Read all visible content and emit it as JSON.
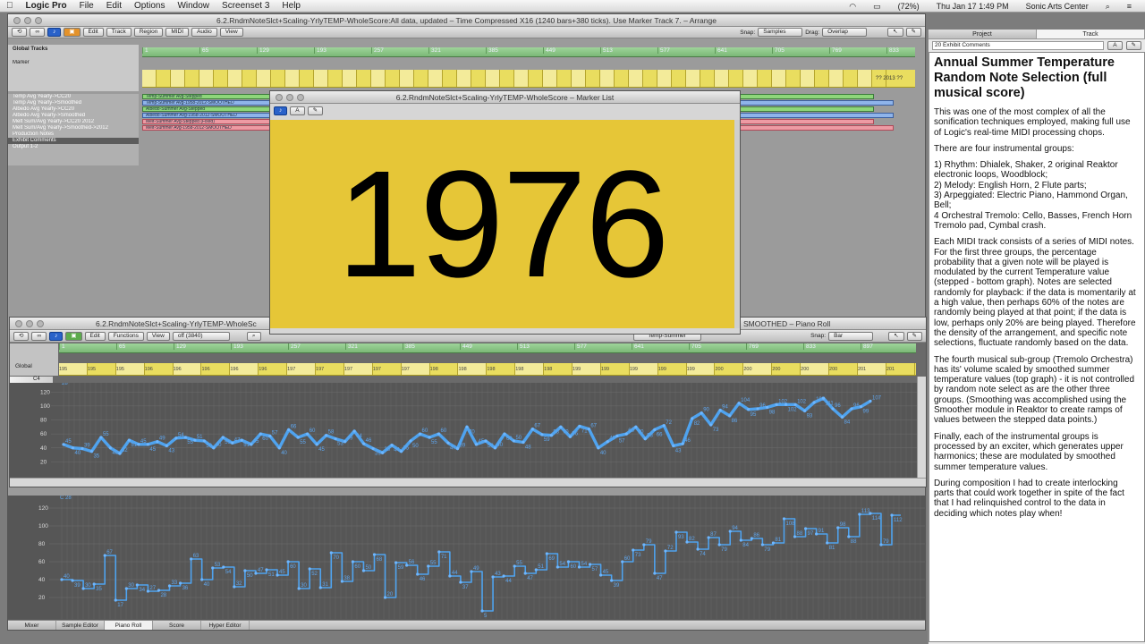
{
  "menubar": {
    "app": "Logic Pro",
    "items": [
      "File",
      "Edit",
      "Options",
      "Window",
      "Screenset 3",
      "Help"
    ],
    "battery": "(72%)",
    "clock": "Thu Jan 17  1:49 PM",
    "user": "Sonic Arts Center"
  },
  "arrange": {
    "title": "6.2.RndmNoteSlct+Scaling-YrlyTEMP-WholeScore:All data, updated – Time Compressed X16 (1240 bars+380 ticks).  Use Marker Track 7. – Arrange",
    "menus": [
      "Edit",
      "Track",
      "Region",
      "MIDI",
      "Audio",
      "View"
    ],
    "snap_label": "Snap:",
    "snap_value": "Samples",
    "drag_label": "Drag:",
    "drag_value": "Overlap",
    "global_tracks": "Global Tracks",
    "marker_label": "Marker",
    "ruler": [
      "1",
      "65",
      "129",
      "193",
      "257",
      "321",
      "385",
      "449",
      "513",
      "577",
      "641",
      "705",
      "769",
      "833",
      "897",
      "961",
      "1025",
      "1089",
      "1153",
      "1217",
      "1281"
    ],
    "marker_tail": "?? 2013 ??",
    "tracks": [
      "Temp Avg Yearly->CC20",
      "Temp Avg Yearly->Smoothed",
      "Albedo Avg Yearly->CC20",
      "Albedo Avg Yearly->Smoothed",
      "Melt Sum/Avg Yearly->CC20 2012",
      "Melt Sum/Avg Yearly->Smoothed->2012",
      "Production Notes",
      "Exhibit Comments",
      "Output 1-2"
    ],
    "regions": [
      "Temp-Summer Avg-Stepped",
      "Temp-Summer Avg-1958-2012-SMOOTHED",
      "Albedo-Summer Avg-Stepped",
      "Albedo-Summer Avg-1958-2012-SMOOTHED",
      "Melt-Summer Avg-Stepped (Fixed)",
      "Melt-Summer Avg-1958-2012-SMOOTHED"
    ]
  },
  "marker_list": {
    "title": "6.2.RndmNoteSlct+Scaling-YrlyTEMP-WholeScore – Marker List",
    "big_year": "1976"
  },
  "piano_roll": {
    "title_left": "6.2.RndmNoteSlct+Scaling-YrlyTEMP-WholeSc",
    "title_right": "SMOOTHED – Piano Roll",
    "menus": [
      "Edit",
      "Functions",
      "View"
    ],
    "off_value": "off (3840)",
    "region_name": "Temp-Summer",
    "snap_label": "Snap:",
    "snap_value": "Bar",
    "global_label": "Global",
    "c4_label": "C4",
    "ruler": [
      "1",
      "65",
      "129",
      "193",
      "257",
      "321",
      "385",
      "449",
      "513",
      "577",
      "641",
      "705",
      "769",
      "833",
      "897",
      "961",
      "1025",
      "1089",
      "1153",
      "1217"
    ],
    "marker_years": [
      "195",
      "195",
      "195",
      "196",
      "196",
      "196",
      "196",
      "196",
      "197",
      "197",
      "197",
      "197",
      "197",
      "198",
      "198",
      "198",
      "198",
      "198",
      "199",
      "199",
      "199",
      "199",
      "199",
      "200",
      "200",
      "200",
      "200",
      "200",
      "201",
      "201"
    ],
    "marker_tail": "2011 ??"
  },
  "chart_data": [
    {
      "type": "line",
      "name": "smoothed",
      "ylim": [
        0,
        128
      ],
      "yticks": [
        20,
        40,
        60,
        80,
        100,
        120
      ],
      "first_label": "28",
      "values": [
        45,
        40,
        39,
        35,
        55,
        40,
        32,
        51,
        45,
        45,
        49,
        43,
        54,
        55,
        51,
        50,
        40,
        55,
        47,
        51,
        45,
        60,
        57,
        40,
        66,
        55,
        60,
        45,
        58,
        53,
        49,
        64,
        46,
        39,
        33,
        44,
        35,
        50,
        60,
        55,
        60,
        47,
        39,
        70,
        45,
        50,
        40,
        60,
        50,
        48,
        67,
        59,
        58,
        70,
        56,
        71,
        67,
        40,
        49,
        57,
        60,
        70,
        53,
        66,
        72,
        43,
        46,
        82,
        90,
        73,
        94,
        86,
        104,
        95,
        96,
        98,
        102,
        102,
        102,
        93,
        105,
        111,
        96,
        84,
        96,
        99,
        107
      ]
    },
    {
      "type": "line",
      "name": "stepped",
      "ylim": [
        0,
        128
      ],
      "yticks": [
        20,
        40,
        60,
        80,
        100,
        120
      ],
      "first_label": "C 28",
      "values": [
        40,
        39,
        30,
        35,
        67,
        17,
        30,
        34,
        27,
        28,
        33,
        36,
        63,
        40,
        53,
        54,
        32,
        50,
        47,
        51,
        45,
        60,
        30,
        52,
        31,
        70,
        38,
        60,
        50,
        68,
        20,
        59,
        56,
        46,
        55,
        71,
        44,
        37,
        49,
        5,
        43,
        44,
        55,
        47,
        51,
        69,
        54,
        60,
        54,
        57,
        45,
        39,
        60,
        73,
        79,
        47,
        72,
        93,
        82,
        74,
        87,
        79,
        94,
        84,
        86,
        79,
        81,
        108,
        88,
        97,
        91,
        81,
        98,
        88,
        113,
        114,
        79,
        112
      ]
    }
  ],
  "inspector": {
    "tabs": [
      "Project",
      "Track"
    ],
    "notes_header": "20 Exhibit Comments",
    "heading": "Annual Summer Temperature Random Note Selection (full musical score)",
    "paragraphs": [
      "This was one of the most complex of all the sonification techniques employed, making full use of Logic's real-time MIDI processing chops.",
      "There are four instrumental groups:",
      "1) Rhythm:  Dhialek, Shaker, 2 original Reaktor electronic loops,  Woodblock;",
      "2) Melody:  English Horn, 2 Flute parts;",
      "3) Arpeggiated:  Electric Piano, Hammond Organ, Bell;",
      "4 Orchestral Tremolo:  Cello, Basses, French Horn Tremolo pad, Cymbal crash.",
      "Each MIDI track consists of a series of MIDI notes.  For the first three groups, the percentage probability that a given note will be played is modulated by the current Temperature value (stepped - bottom graph).  Notes are selected randomly for playback:  if the data is momentarily at a high value, then perhaps 60% of the notes are randomly being played at that point;  if the data is low, perhaps only 20% are being played.  Therefore the density of the arrangement, and specific note selections, fluctuate randomly based on the data.",
      "The fourth musical sub-group (Tremolo Orchestra) has its' volume scaled by smoothed summer temperature values (top graph) - it is not controlled by random note select as are the other three groups.  (Smoothing was accomplished using the Smoother module in Reaktor to create ramps of values between the stepped data points.)",
      "Finally, each of the instrumental groups is processed by an exciter, which generates upper harmonics;  these are modulated by smoothed summer temperature values.",
      "During composition I had to create interlocking parts that could work together in spite of the fact that I had relinquished control to the data in deciding which notes play when!"
    ]
  },
  "bottom_tabs": [
    "Mixer",
    "Sample Editor",
    "Piano Roll",
    "Score",
    "Hyper Editor"
  ],
  "colors": {
    "marker_yellow": "#e6c637",
    "line_blue": "#4fa3ef",
    "ruler_green": "#8cc787"
  }
}
